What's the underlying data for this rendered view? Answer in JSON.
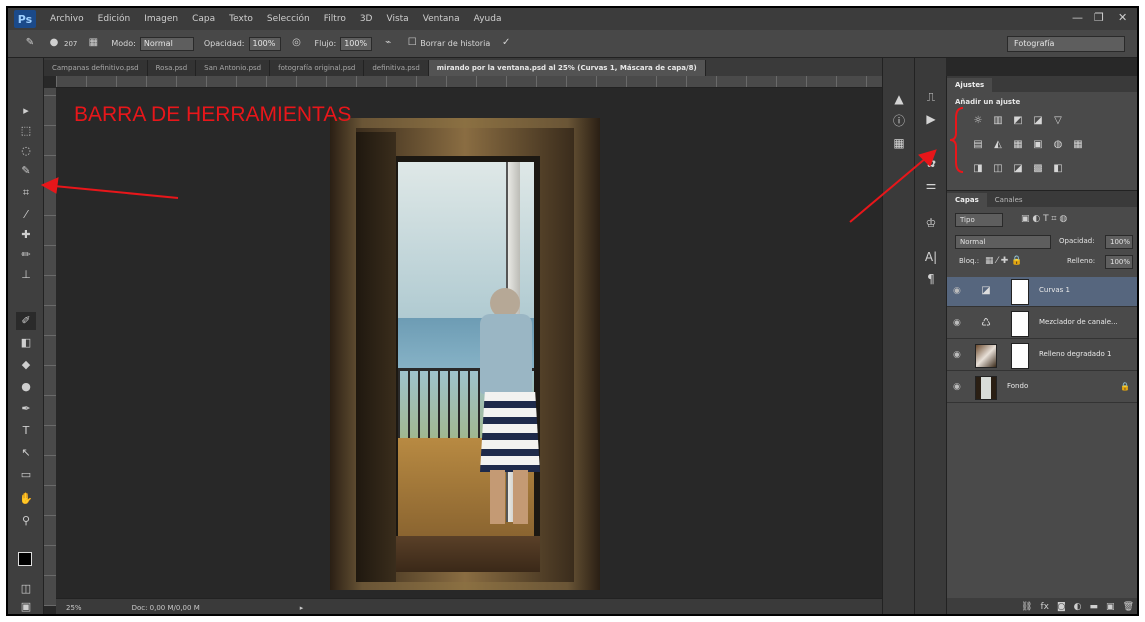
{
  "app": {
    "logo": "Ps"
  },
  "menu": [
    "Archivo",
    "Edición",
    "Imagen",
    "Capa",
    "Texto",
    "Selección",
    "Filtro",
    "3D",
    "Vista",
    "Ventana",
    "Ayuda"
  ],
  "window_controls": {
    "minimize": "—",
    "restore": "❐",
    "close": "✕"
  },
  "options_bar": {
    "brush_size": "207",
    "mode_label": "Modo:",
    "mode_value": "Normal",
    "opacity_label": "Opacidad:",
    "opacity_value": "100%",
    "flow_label": "Flujo:",
    "flow_value": "100%",
    "history_label": "Borrar de historia",
    "workspace": "Fotografía"
  },
  "doc_tabs": [
    {
      "label": "Campanas definitivo.psd",
      "active": false
    },
    {
      "label": "Rosa.psd",
      "active": false
    },
    {
      "label": "San Antonio.psd",
      "active": false
    },
    {
      "label": "fotografía original.psd",
      "active": false
    },
    {
      "label": "definitiva.psd",
      "active": false
    },
    {
      "label": "mirando por la ventana.psd al 25% (Curvas 1, Máscara de capa/8)",
      "active": true
    }
  ],
  "annotation": {
    "label": "BARRA DE HERRAMIENTAS",
    "color": "#e8161a"
  },
  "status": {
    "zoom": "25%",
    "doc": "Doc: 0,00 M/0,00 M"
  },
  "panels": {
    "adjust_tab": "Ajustes",
    "adjust_title": "Añadir un ajuste",
    "adjust_row1": [
      "☼",
      "▥",
      "◩",
      "◪",
      "▽"
    ],
    "adjust_row2": [
      "▤",
      "◭",
      "▦",
      "▣",
      "◍",
      "▦"
    ],
    "adjust_row3": [
      "◨",
      "◫",
      "◪",
      "▩",
      "◧"
    ],
    "layers_tab": "Capas",
    "channels_tab": "Canales",
    "kind_label": "Tipo",
    "blend_mode": "Normal",
    "opacity_label": "Opacidad:",
    "opacity_value": "100%",
    "lock_label": "Bloq.:",
    "fill_label": "Relleno:",
    "fill_value": "100%",
    "layers": [
      {
        "name": "Curvas 1",
        "selected": true,
        "icon": "curves-icon"
      },
      {
        "name": "Mezclador de canale...",
        "selected": false,
        "icon": "channel-mixer-icon"
      },
      {
        "name": "Relleno degradado 1",
        "selected": false,
        "icon": "gradient-fill-icon"
      },
      {
        "name": "Fondo",
        "selected": false,
        "icon": "background-icon"
      }
    ]
  },
  "colors": {
    "selected_layer": "#56667e",
    "annotation": "#e8161a"
  }
}
